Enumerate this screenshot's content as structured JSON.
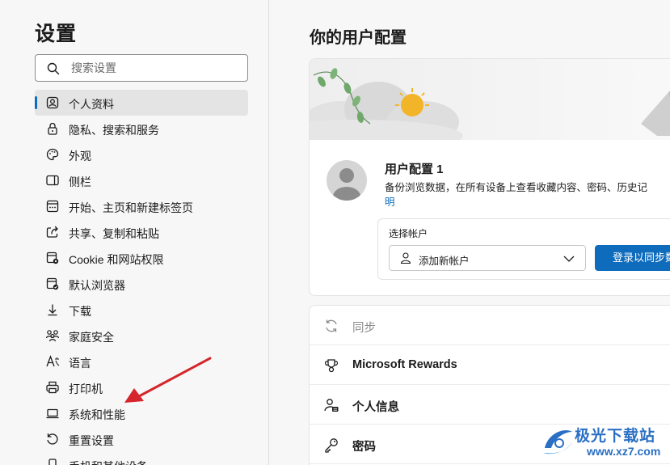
{
  "sidebar": {
    "title": "设置",
    "search": {
      "placeholder": "搜索设置",
      "value": ""
    },
    "items": [
      {
        "label": "个人资料",
        "icon": "profile-icon",
        "active": true
      },
      {
        "label": "隐私、搜索和服务",
        "icon": "lock-icon"
      },
      {
        "label": "外观",
        "icon": "palette-icon"
      },
      {
        "label": "侧栏",
        "icon": "sidebar-panel-icon"
      },
      {
        "label": "开始、主页和新建标签页",
        "icon": "home-tab-icon"
      },
      {
        "label": "共享、复制和粘贴",
        "icon": "share-icon"
      },
      {
        "label": "Cookie 和网站权限",
        "icon": "cookie-settings-icon"
      },
      {
        "label": "默认浏览器",
        "icon": "browser-icon"
      },
      {
        "label": "下载",
        "icon": "download-icon"
      },
      {
        "label": "家庭安全",
        "icon": "family-icon"
      },
      {
        "label": "语言",
        "icon": "language-icon"
      },
      {
        "label": "打印机",
        "icon": "printer-icon"
      },
      {
        "label": "系统和性能",
        "icon": "laptop-icon"
      },
      {
        "label": "重置设置",
        "icon": "reset-icon"
      },
      {
        "label": "手机和其他设备",
        "icon": "phone-icon"
      }
    ]
  },
  "main": {
    "title": "你的用户配置",
    "profile": {
      "name": "用户配置 1",
      "description": "备份浏览数据，在所有设备上查看收藏内容、密码、历史记",
      "description_link": "明",
      "account_label": "选择帐户",
      "account_value": "添加新帐户",
      "sign_in_label": "登录以同步数"
    },
    "settings_rows": [
      {
        "label": "同步",
        "icon": "sync-icon",
        "disabled": true
      },
      {
        "label": "Microsoft Rewards",
        "icon": "trophy-icon",
        "disabled": false
      },
      {
        "label": "个人信息",
        "icon": "personal-info-icon",
        "disabled": false
      },
      {
        "label": "密码",
        "icon": "key-icon",
        "disabled": false
      }
    ]
  },
  "watermark": {
    "text": "极光下载站",
    "url": "www.xz7.com"
  },
  "colors": {
    "accent": "#0f6cbd",
    "annotation_arrow": "#d4262b",
    "watermark": "#2b6fc4"
  }
}
